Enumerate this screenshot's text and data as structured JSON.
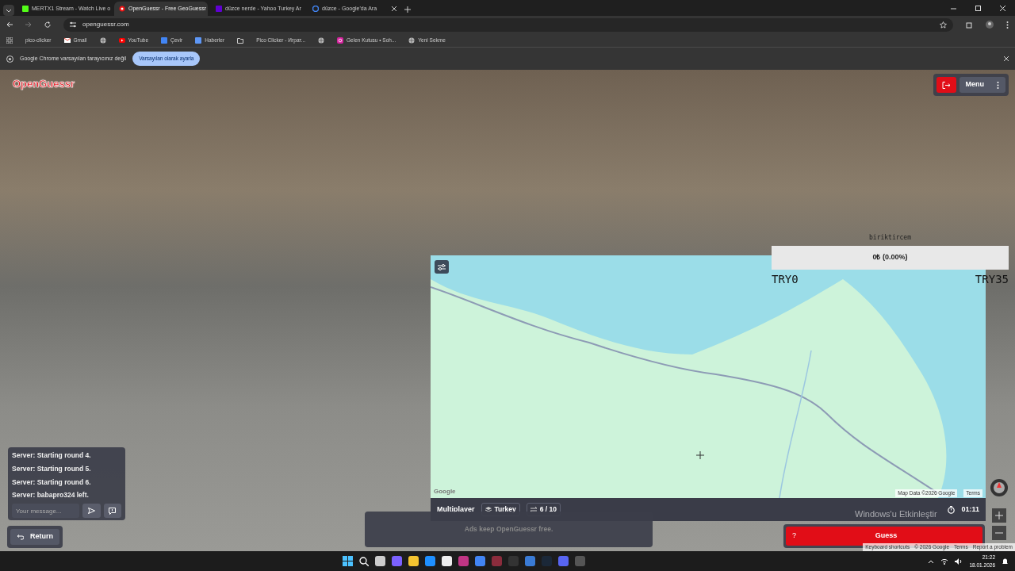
{
  "browser": {
    "tabs": [
      {
        "title": "MERTX1 Stream - Watch Live o",
        "kind": "kick",
        "selected": false
      },
      {
        "title": "OpenGuessr - Free GeoGuessr",
        "kind": "openguessr",
        "selected": true
      },
      {
        "title": "düzce nerde - Yahoo Turkey Ar",
        "kind": "yahoo",
        "selected": false
      },
      {
        "title": "düzce - Google'da Ara",
        "kind": "google",
        "selected": false
      }
    ],
    "address": "openguessr.com",
    "bookmarks": [
      {
        "kind": "page",
        "label": "pico-clicker"
      },
      {
        "kind": "gmail",
        "label": "Gmail"
      },
      {
        "kind": "globe"
      },
      {
        "kind": "youtube",
        "label": "YouTube"
      },
      {
        "kind": "translate",
        "label": "Çevir"
      },
      {
        "kind": "news",
        "label": "Haberler"
      },
      {
        "kind": "folder"
      },
      {
        "kind": "page",
        "label": "Pico Clicker - Играт..."
      },
      {
        "kind": "globe"
      },
      {
        "kind": "instagram",
        "label": "Gelen Kutusu • Soh..."
      },
      {
        "kind": "globe",
        "label": "Yeni Sekme"
      }
    ],
    "infobar": {
      "message": "Google Chrome varsayılan tarayıcınız değil",
      "button": "Varsayılan olarak ayarla"
    }
  },
  "game": {
    "logo": "OpenGuessr",
    "menu": "Menu",
    "goal": {
      "title": "biriktircem",
      "amount": "0₺ (0.00%)",
      "level": 0,
      "min": "TRY0",
      "max": "TRY35"
    },
    "chat": {
      "messages": [
        "Server: Starting round 4.",
        "Server: Starting round 5.",
        "Server: Starting round 6.",
        "Server: babapro324 left."
      ],
      "placeholder": "Your message..."
    },
    "return": "Return",
    "map": {
      "google": "Google",
      "attribution": "Map Data ©2026 Google",
      "terms": "Terms"
    },
    "footer": {
      "mode": "Multiplayer",
      "region": "Turkey",
      "round": "6 / 10",
      "timer": "01:11"
    },
    "ads": "Ads keep OpenGuessr free.",
    "guess": {
      "hint": "?",
      "label": "Guess"
    },
    "streetview_footer": [
      "Keyboard shortcuts",
      "© 2026 Google",
      "Terms",
      "Report a problem"
    ]
  },
  "os": {
    "watermark": "Windows'u Etkinleştir",
    "time": "21:22",
    "date": "18.01.2026"
  }
}
